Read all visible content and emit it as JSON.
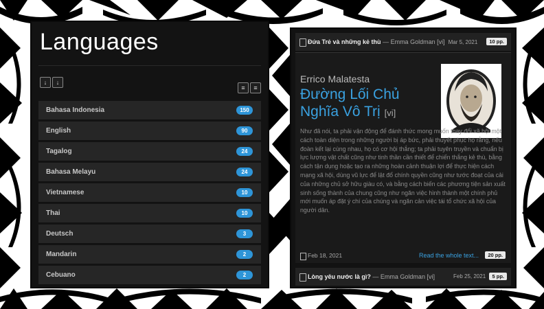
{
  "languages": {
    "title": "Languages",
    "items": [
      {
        "name": "Bahasa Indonesia",
        "count": "150"
      },
      {
        "name": "English",
        "count": "90"
      },
      {
        "name": "Tagalog",
        "count": "24"
      },
      {
        "name": "Bahasa Melayu",
        "count": "24"
      },
      {
        "name": "Vietnamese",
        "count": "10"
      },
      {
        "name": "Thai",
        "count": "10"
      },
      {
        "name": "Deutsch",
        "count": "3"
      },
      {
        "name": "Mandarin",
        "count": "2"
      },
      {
        "name": "Cebuano",
        "count": "2"
      }
    ]
  },
  "feed": {
    "top": {
      "title": "Đứa Trẻ và những kẻ thù",
      "meta": " — Emma Goldman [vi]",
      "date": "Mar 5, 2021",
      "pages": "10 pp."
    },
    "feature": {
      "author": "Errico Malatesta",
      "title": "Đường Lối Chủ Nghĩa Vô Trị",
      "lang": "[vi]",
      "excerpt": "Như đã nói, ta phải vận động để đánh thức mong muốn thay đổi xã hội một cách toàn diện trong những người bị áp bức, phải thuyết phục họ rằng, nếu đoàn kết lại cùng nhau, họ có cơ hội thắng; ta phải tuyên truyền và chuẩn bị lực lượng vật chất cũng như tinh thần cần thiết để chiến thắng kẻ thù, bằng cách tận dụng hoặc tạo ra những hoàn cảnh thuận lợi để thực hiện cách mạng xã hội, dùng vũ lực để lật đổ chính quyền cũng như tước đoạt của cải của những chủ sở hữu giàu có, và bằng cách biến các phương tiện sản xuất sinh sống thành của chung cũng như ngăn việc hình thành một chính phủ mới muốn áp đặt ý chí của chúng và ngăn cản việc tái tổ chức xã hội của người dân.",
      "date": "Feb 18, 2021",
      "readmore": "Read the whole text...",
      "pages": "20 pp."
    },
    "bottom": {
      "title": "Lòng yêu nước là gì?",
      "meta": " — Emma Goldman [vi]",
      "date": "Feb 25, 2021",
      "pages": "5 pp."
    }
  },
  "icons": [
    "sort-alpha-asc-icon",
    "sort-alpha-desc-icon",
    "sort-amount-asc-icon",
    "sort-amount-desc-icon",
    "document-icon"
  ]
}
